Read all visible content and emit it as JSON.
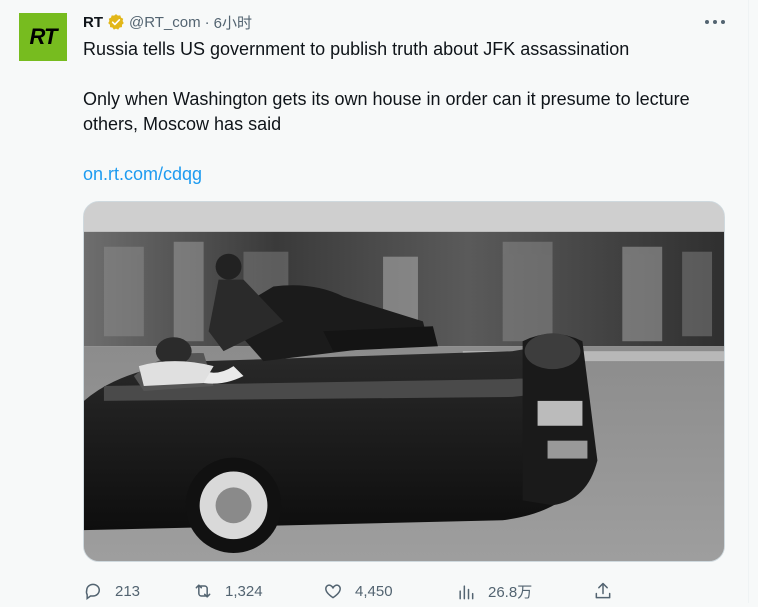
{
  "tweet": {
    "author_name": "RT",
    "avatar_text": "RT",
    "handle": "@RT_com",
    "separator": "·",
    "time": "6小时",
    "headline": "Russia tells US government to publish truth about JFK assassination",
    "body": "Only when Washington gets its own house in order can it presume to lecture others, Moscow has said",
    "link": "on.rt.com/cdqg"
  },
  "media": {
    "icon": "photo-motorcade"
  },
  "actions": {
    "replies": "213",
    "retweets": "1,324",
    "likes": "4,450",
    "views": "26.8万"
  },
  "colors": {
    "avatar_bg": "#77bc1f",
    "link": "#1d9bf0",
    "muted": "#536471",
    "verified_gold": "#e2b719"
  }
}
